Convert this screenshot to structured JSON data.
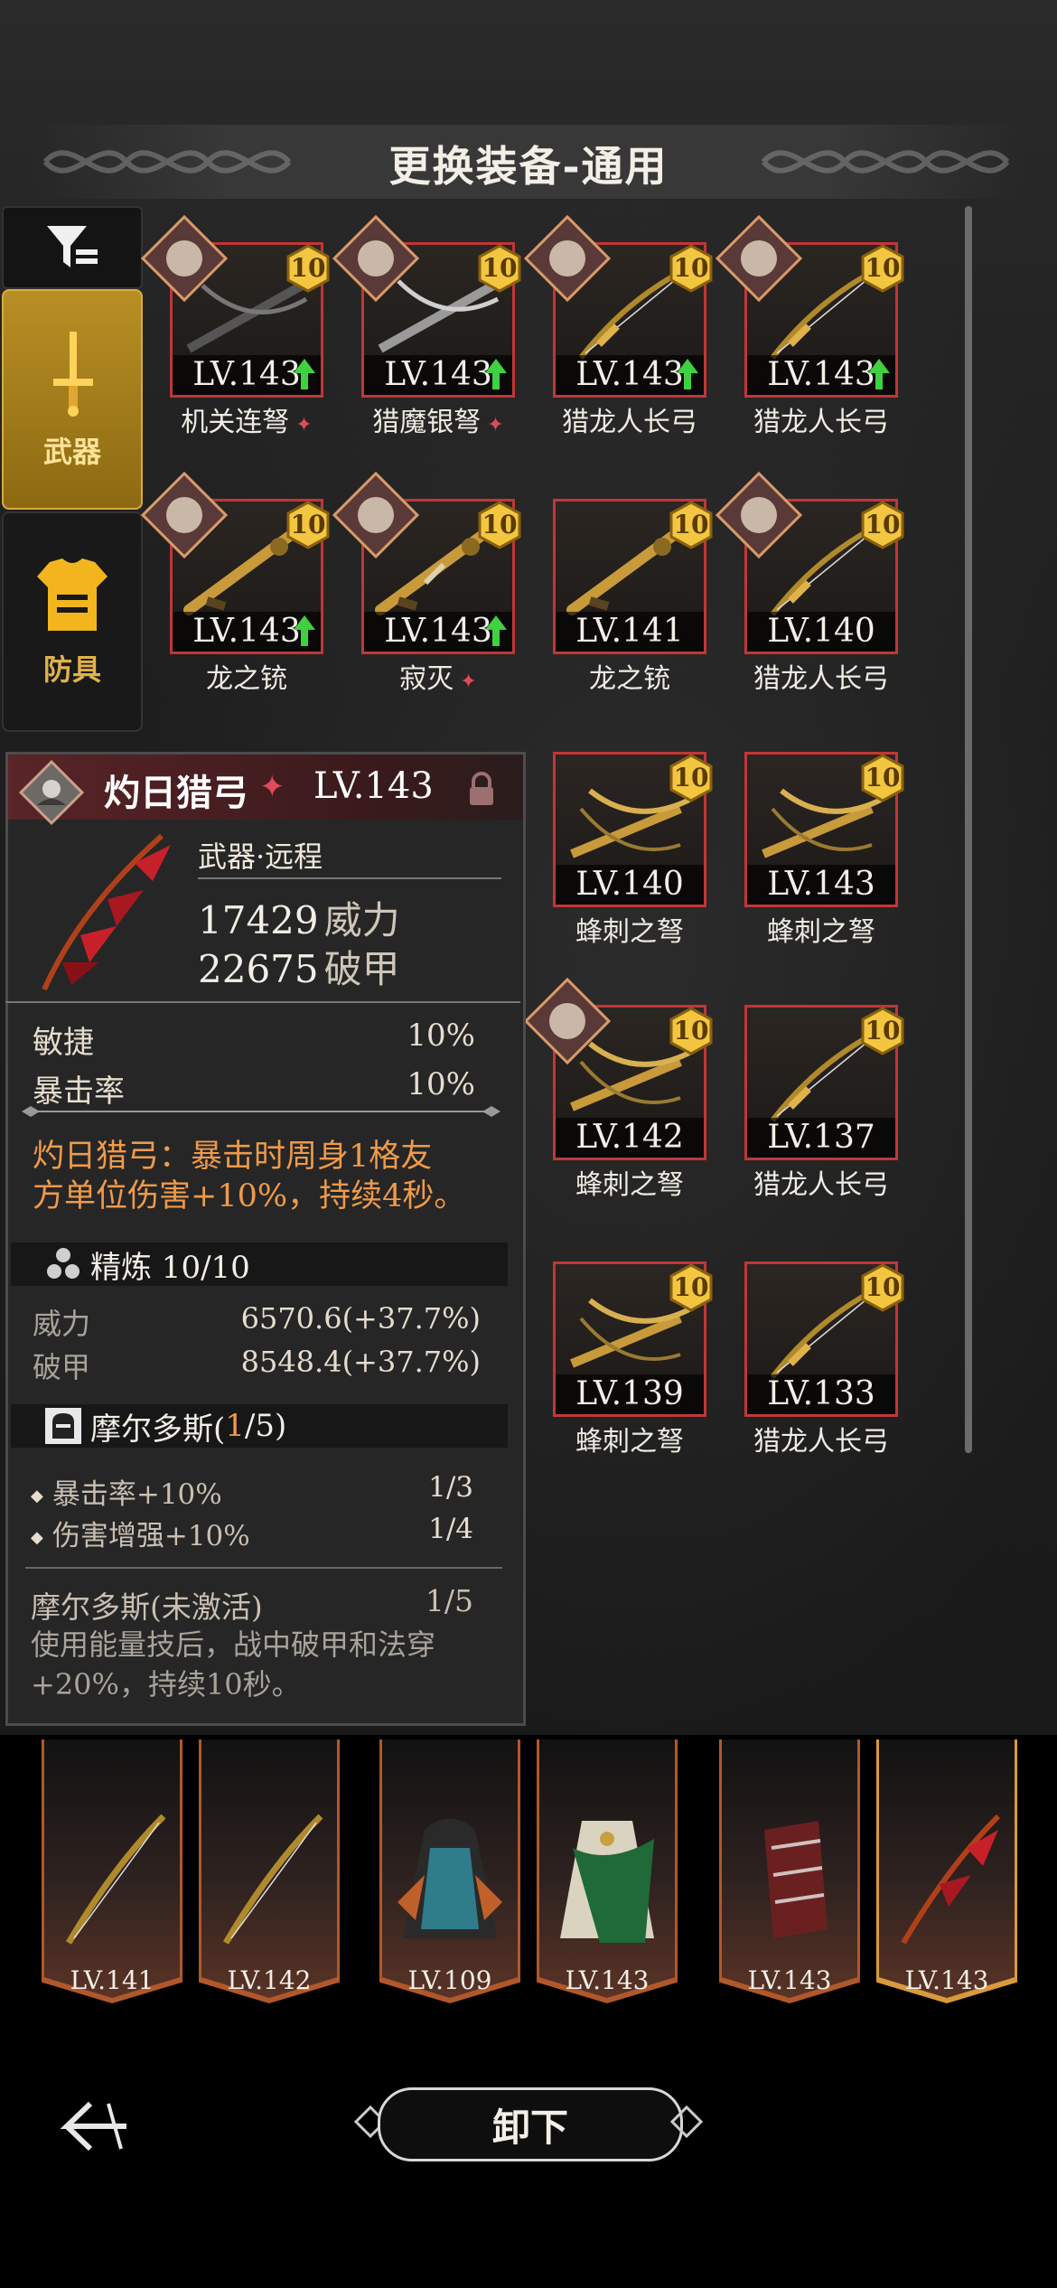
{
  "header": {
    "title": "更换装备-通用"
  },
  "tabs": [
    {
      "label": "武器",
      "active": true
    },
    {
      "label": "防具",
      "active": false
    }
  ],
  "grid": [
    {
      "name": "机关连弩",
      "level": "LV.143",
      "refine": "10",
      "upgrade": true,
      "relic": true,
      "portrait": true,
      "weapon": "crossbow-dark"
    },
    {
      "name": "猎魔银弩",
      "level": "LV.143",
      "refine": "10",
      "upgrade": true,
      "relic": true,
      "portrait": true,
      "weapon": "crossbow-silver"
    },
    {
      "name": "猎龙人长弓",
      "level": "LV.143",
      "refine": "10",
      "upgrade": true,
      "relic": false,
      "portrait": true,
      "weapon": "longbow"
    },
    {
      "name": "猎龙人长弓",
      "level": "LV.143",
      "refine": "10",
      "upgrade": true,
      "relic": false,
      "portrait": true,
      "weapon": "longbow"
    },
    {
      "name": "龙之铳",
      "level": "LV.143",
      "refine": "10",
      "upgrade": true,
      "relic": false,
      "portrait": true,
      "weapon": "gun"
    },
    {
      "name": "寂灭",
      "level": "LV.143",
      "refine": "10",
      "upgrade": true,
      "relic": true,
      "portrait": true,
      "weapon": "gun-ornate"
    },
    {
      "name": "龙之铳",
      "level": "LV.141",
      "refine": "10",
      "upgrade": false,
      "relic": false,
      "portrait": false,
      "weapon": "gun"
    },
    {
      "name": "猎龙人长弓",
      "level": "LV.140",
      "refine": "10",
      "upgrade": false,
      "relic": false,
      "portrait": true,
      "weapon": "longbow"
    },
    {
      "name": "蜂刺之弩",
      "level": "LV.140",
      "refine": "10",
      "upgrade": false,
      "relic": false,
      "portrait": false,
      "weapon": "crossbow-gold"
    },
    {
      "name": "蜂刺之弩",
      "level": "LV.143",
      "refine": "10",
      "upgrade": false,
      "relic": false,
      "portrait": false,
      "weapon": "crossbow-gold"
    },
    {
      "name": "蜂刺之弩",
      "level": "LV.142",
      "refine": "10",
      "upgrade": false,
      "relic": false,
      "portrait": true,
      "weapon": "crossbow-gold"
    },
    {
      "name": "猎龙人长弓",
      "level": "LV.137",
      "refine": "10",
      "upgrade": false,
      "relic": false,
      "portrait": false,
      "weapon": "longbow"
    },
    {
      "name": "蜂刺之弩",
      "level": "LV.139",
      "refine": "10",
      "upgrade": false,
      "relic": false,
      "portrait": false,
      "weapon": "crossbow-gold"
    },
    {
      "name": "猎龙人长弓",
      "level": "LV.133",
      "refine": "10",
      "upgrade": false,
      "relic": false,
      "portrait": false,
      "weapon": "longbow"
    }
  ],
  "detail": {
    "name": "灼日猎弓",
    "level": "LV.143",
    "type": "武器·远程",
    "power_value": "17429",
    "power_label": "威力",
    "armor_value": "22675",
    "armor_label": "破甲",
    "stats": [
      {
        "label": "敏捷",
        "value": "10%"
      },
      {
        "label": "暴击率",
        "value": "10%"
      }
    ],
    "effect_line1": "灼日猎弓：暴击时周身1格友",
    "effect_line2": "方单位伤害+10%，持续4秒。",
    "refine_title": "精炼 10/10",
    "refine_rows": [
      {
        "label": "威力",
        "value": "6570.6(+37.7%)"
      },
      {
        "label": "破甲",
        "value": "8548.4(+37.7%)"
      }
    ],
    "set_title": "摩尔多斯(",
    "set_count": "1",
    "set_total": "/5)",
    "set_rows": [
      {
        "label": "暴击率+10%",
        "value": "1/3"
      },
      {
        "label": "伤害增强+10%",
        "value": "1/4"
      }
    ],
    "set_bonus_label": "摩尔多斯(未激活)",
    "set_bonus_value": "1/5",
    "set_desc_line1": "使用能量技后，战中破甲和法穿",
    "set_desc_line2": "+20%，持续10秒。"
  },
  "equipped": [
    {
      "level": "LV.141",
      "item": "longbow"
    },
    {
      "level": "LV.142",
      "item": "longbow"
    },
    {
      "level": "LV.109",
      "item": "cloak"
    },
    {
      "level": "LV.143",
      "item": "robe"
    },
    {
      "level": "LV.143",
      "item": "bracer"
    },
    {
      "level": "LV.143",
      "item": "redbow"
    }
  ],
  "footer": {
    "unequip_label": "卸下"
  },
  "colors": {
    "accent_gold": "#d7ad3a",
    "card_border": "#c23636",
    "effect_orange": "#ef9a4a"
  }
}
